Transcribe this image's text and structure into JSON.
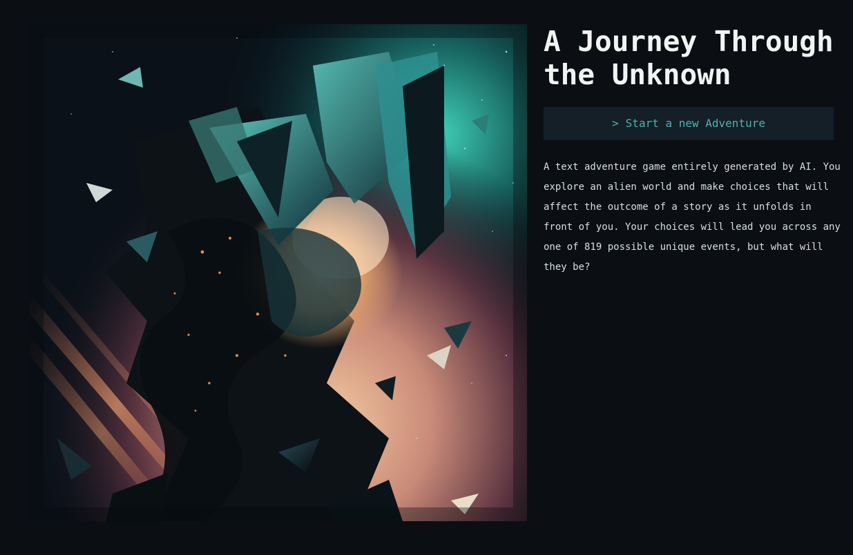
{
  "hero": {
    "image_subject": "abstract cosmic explosion with shattered crystal shards"
  },
  "game": {
    "title": "A Journey Through the Unknown",
    "start_caret": ">",
    "start_label": "Start a new Adventure",
    "description": "A text adventure game entirely generated by AI. You explore an alien world and make choices that will affect the outcome of a story as it unfolds in front of you. Your choices will lead you across any one of 819 possible unique events, but what will they be?"
  },
  "colors": {
    "background": "#0b0f13",
    "accent": "#4fb3b0",
    "button_bg": "#141f28",
    "title": "#f2f4f3"
  }
}
